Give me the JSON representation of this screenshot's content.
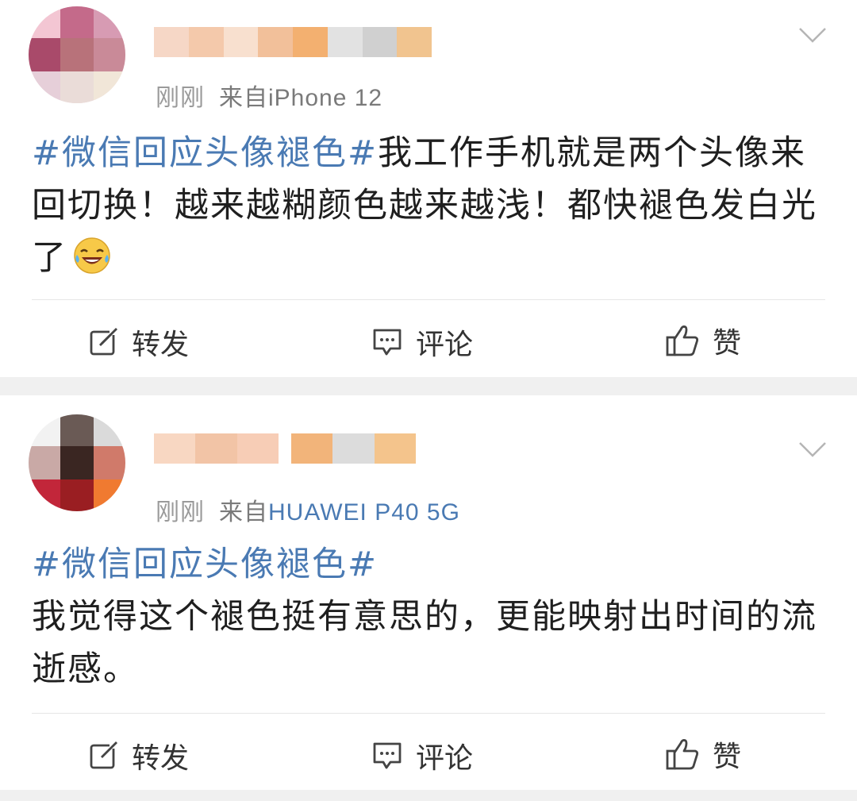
{
  "posts": [
    {
      "time": "刚刚",
      "source": "来自iPhone 12",
      "tag": "#微信回应头像褪色#",
      "text": "我工作手机就是两个头像来回切换！越来越糊颜色越来越浅！都快褪色发白光了",
      "emoji": "laugh-crying-emoji",
      "actions": {
        "repost": "转发",
        "comment": "评论",
        "like": "赞"
      }
    },
    {
      "time": "刚刚",
      "source_prefix": "来自",
      "source": "HUAWEI P40 5G",
      "tag": "#微信回应头像褪色#",
      "text": "我觉得这个褪色挺有意思的，更能映射出时间的流逝感。",
      "actions": {
        "repost": "转发",
        "comment": "评论",
        "like": "赞"
      }
    }
  ],
  "colors": {
    "tag": "#4a7ab3",
    "meta": "#9a9a9a",
    "background": "#f0f0f0"
  }
}
